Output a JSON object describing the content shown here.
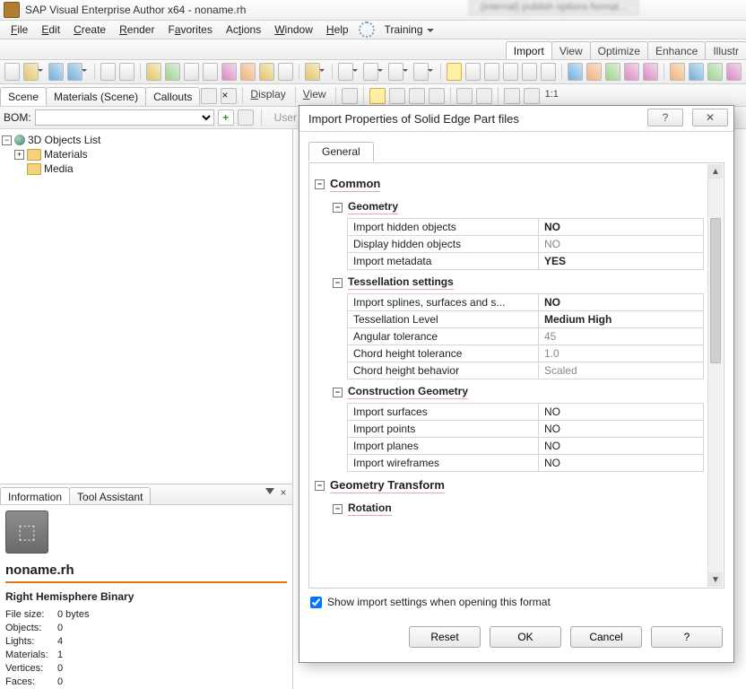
{
  "title": "SAP Visual Enterprise Author x64 - noname.rh",
  "blur_tab": "(internal) publish options format...",
  "menu": [
    "File",
    "Edit",
    "Create",
    "Render",
    "Favorites",
    "Actions",
    "Window",
    "Help",
    "Training"
  ],
  "right_tabs": [
    "Import",
    "View",
    "Optimize",
    "Enhance",
    "Illustr"
  ],
  "right_tab_active": "Import",
  "panel_tabs_left": [
    "Scene",
    "Materials (Scene)",
    "Callouts"
  ],
  "panel_tabs_left_active": "Scene",
  "panel_labels_right": [
    "Display",
    "View"
  ],
  "bom_label": "BOM:",
  "user_label": "User",
  "tree": {
    "root": "3D Objects List",
    "materials": "Materials",
    "media": "Media"
  },
  "info_tabs": [
    "Information",
    "Tool Assistant"
  ],
  "info_active": "Information",
  "file": {
    "name": "noname.rh",
    "type": "Right Hemisphere Binary",
    "stats": [
      [
        "File size:",
        "0 bytes"
      ],
      [
        "Objects:",
        "0"
      ],
      [
        "Lights:",
        "4"
      ],
      [
        "Materials:",
        "1"
      ],
      [
        "Vertices:",
        "0"
      ],
      [
        "Faces:",
        "0"
      ]
    ]
  },
  "dialog": {
    "title": "Import Properties of Solid Edge Part files",
    "tab": "General",
    "checkbox": "Show import settings when opening this format",
    "checkbox_checked": true,
    "buttons": [
      "Reset",
      "OK",
      "Cancel",
      "?"
    ],
    "groups": [
      {
        "title": "Common",
        "level": 0
      },
      {
        "title": "Geometry",
        "level": 1,
        "rows": [
          [
            "Import hidden objects",
            "NO",
            "bold"
          ],
          [
            "Display hidden objects",
            "NO",
            "dim"
          ],
          [
            "Import metadata",
            "YES",
            "bold"
          ]
        ]
      },
      {
        "title": "Tessellation settings",
        "level": 1,
        "rows": [
          [
            "Import splines, surfaces and s...",
            "NO",
            "bold"
          ],
          [
            "Tessellation Level",
            "Medium High",
            "bold"
          ],
          [
            "Angular tolerance",
            "45",
            "dim"
          ],
          [
            "Chord height tolerance",
            "1.0",
            "dim"
          ],
          [
            "Chord height behavior",
            "Scaled",
            "dim"
          ]
        ]
      },
      {
        "title": "Construction Geometry",
        "level": 1,
        "rows": [
          [
            "Import surfaces",
            "NO",
            ""
          ],
          [
            "Import points",
            "NO",
            ""
          ],
          [
            "Import planes",
            "NO",
            ""
          ],
          [
            "Import wireframes",
            "NO",
            ""
          ]
        ]
      },
      {
        "title": "Geometry Transform",
        "level": 0
      },
      {
        "title": "Rotation",
        "level": 1
      }
    ]
  }
}
